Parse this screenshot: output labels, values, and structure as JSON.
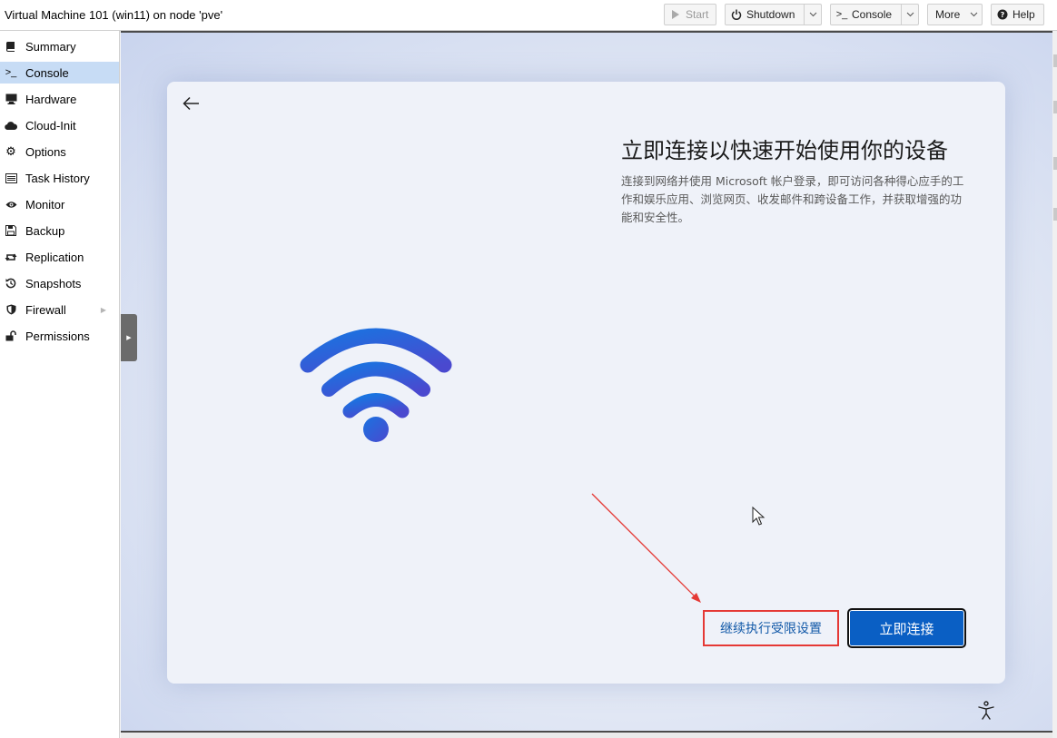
{
  "window": {
    "title": "Virtual Machine 101 (win11) on node 'pve'"
  },
  "toolbar": {
    "start_label": "Start",
    "shutdown_label": "Shutdown",
    "console_label": "Console",
    "more_label": "More",
    "help_label": "Help"
  },
  "sidebar": {
    "items": [
      {
        "label": "Summary",
        "icon": "book-icon"
      },
      {
        "label": "Console",
        "icon": "terminal-icon",
        "active": true
      },
      {
        "label": "Hardware",
        "icon": "monitor-icon"
      },
      {
        "label": "Cloud-Init",
        "icon": "cloud-icon"
      },
      {
        "label": "Options",
        "icon": "gear-icon"
      },
      {
        "label": "Task History",
        "icon": "list-icon"
      },
      {
        "label": "Monitor",
        "icon": "eye-icon"
      },
      {
        "label": "Backup",
        "icon": "floppy-icon"
      },
      {
        "label": "Replication",
        "icon": "retweet-icon"
      },
      {
        "label": "Snapshots",
        "icon": "history-icon"
      },
      {
        "label": "Firewall",
        "icon": "shield-icon",
        "expandable": true
      },
      {
        "label": "Permissions",
        "icon": "unlock-icon"
      }
    ]
  },
  "oobe": {
    "heading": "立即连接以快速开始使用你的设备",
    "description": "连接到网络并使用 Microsoft 帐户登录，即可访问各种得心应手的工作和娱乐应用、浏览网页、收发邮件和跨设备工作，并获取增强的功能和安全性。",
    "limited_setup_label": "继续执行受限设置",
    "connect_label": "立即连接"
  },
  "colors": {
    "accent": "#0a5fc4",
    "annotation": "#e53935",
    "sidebar_active": "#c7dcf5"
  }
}
